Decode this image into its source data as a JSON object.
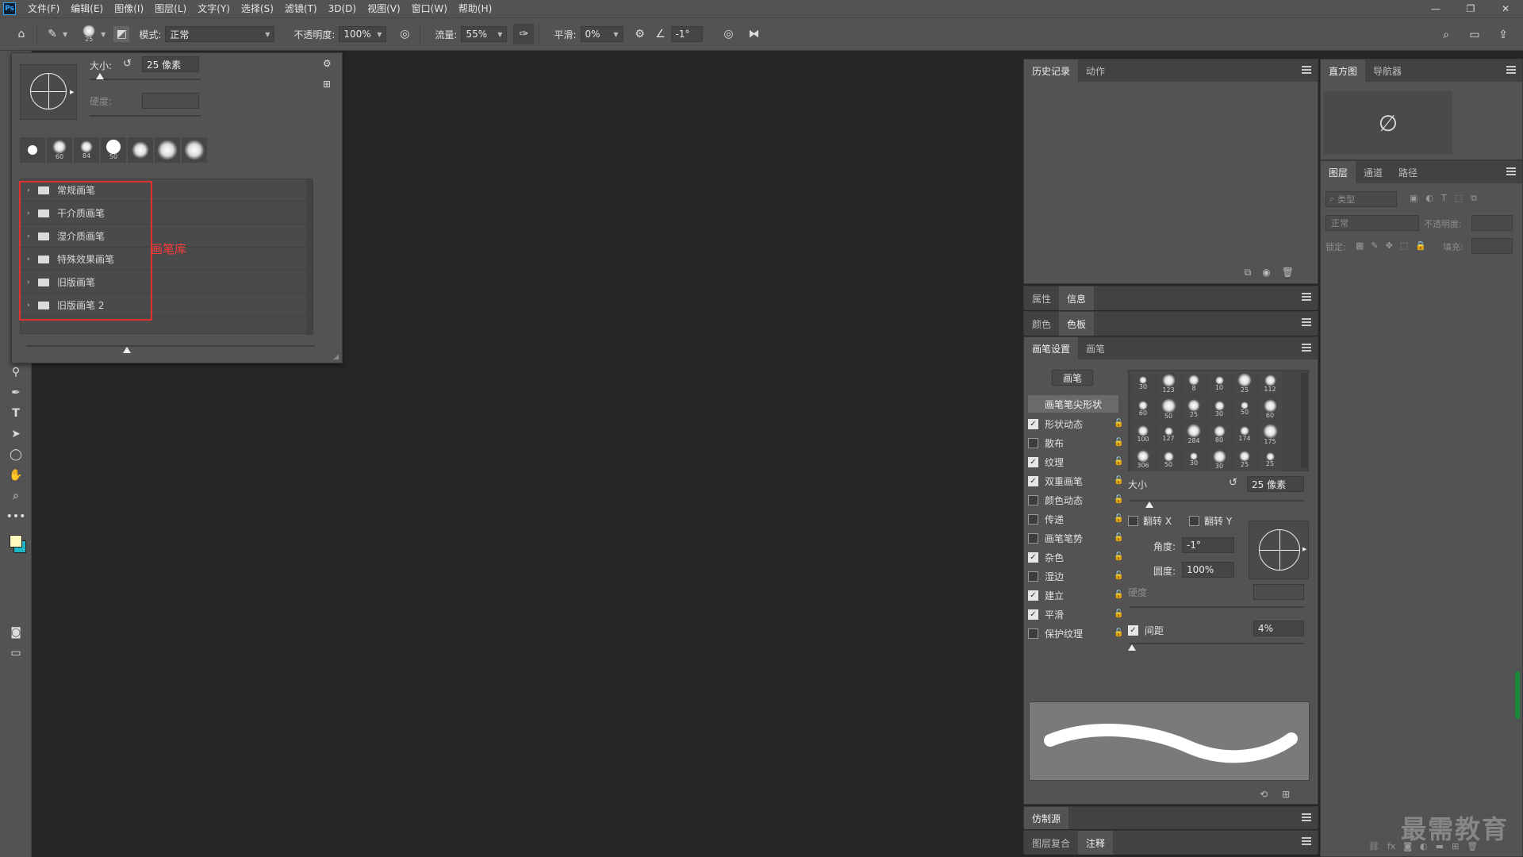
{
  "app": {
    "logo": "Ps"
  },
  "menu": [
    "文件(F)",
    "编辑(E)",
    "图像(I)",
    "图层(L)",
    "文字(Y)",
    "选择(S)",
    "滤镜(T)",
    "3D(D)",
    "视图(V)",
    "窗口(W)",
    "帮助(H)"
  ],
  "window_controls": {
    "minimize": "—",
    "restore": "❐",
    "close": "✕"
  },
  "options": {
    "brush_size_badge": "25",
    "mode_label": "模式:",
    "mode_value": "正常",
    "opacity_label": "不透明度:",
    "opacity_value": "100%",
    "flow_label": "流量:",
    "flow_value": "55%",
    "smooth_label": "平滑:",
    "smooth_value": "0%",
    "angle_value": "-1°"
  },
  "brush_popup": {
    "size_label": "大小:",
    "size_value": "25 像素",
    "hardness_label": "硬度:",
    "thumbs": [
      {
        "num": ""
      },
      {
        "num": "60"
      },
      {
        "num": "84"
      },
      {
        "num": "50"
      },
      {
        "num": ""
      },
      {
        "num": ""
      },
      {
        "num": ""
      }
    ],
    "groups": [
      "常规画笔",
      "干介质画笔",
      "湿介质画笔",
      "特殊效果画笔",
      "旧版画笔",
      "旧版画笔 2"
    ],
    "annotation": "画笔库"
  },
  "panels": {
    "history_tabs": [
      "历史记录",
      "动作"
    ],
    "histogram_tabs": [
      "直方图",
      "导航器"
    ],
    "layers_tabs": [
      "图层",
      "通道",
      "路径"
    ],
    "layers": {
      "search_placeholder": "类型",
      "blend_mode": "正常",
      "opacity_label": "不透明度:",
      "lock_label": "锁定:",
      "fill_label": "填充:"
    },
    "props_tabs": [
      "属性",
      "信息"
    ],
    "color_tabs": [
      "颜色",
      "色板"
    ],
    "brush_settings_tabs": [
      "画笔设置",
      "画笔"
    ],
    "clone_tabs": [
      "仿制源"
    ],
    "bottom_tabs": [
      "图层复合",
      "注释"
    ]
  },
  "brush_settings": {
    "brush_button": "画笔",
    "tip_shape": "画笔笔尖形状",
    "options": [
      {
        "label": "形状动态",
        "checked": true
      },
      {
        "label": "散布",
        "checked": false
      },
      {
        "label": "纹理",
        "checked": true
      },
      {
        "label": "双重画笔",
        "checked": true
      },
      {
        "label": "颜色动态",
        "checked": false
      },
      {
        "label": "传递",
        "checked": false
      },
      {
        "label": "画笔笔势",
        "checked": false
      },
      {
        "label": "杂色",
        "checked": true
      },
      {
        "label": "湿边",
        "checked": false
      },
      {
        "label": "建立",
        "checked": true
      },
      {
        "label": "平滑",
        "checked": true
      },
      {
        "label": "保护纹理",
        "checked": false
      }
    ],
    "presets": [
      "30",
      "123",
      "8",
      "10",
      "25",
      "112",
      "60",
      "50",
      "25",
      "30",
      "50",
      "60",
      "100",
      "127",
      "284",
      "80",
      "174",
      "175",
      "306",
      "50",
      "30",
      "30",
      "25",
      "25"
    ],
    "size_label": "大小",
    "size_value": "25 像素",
    "flip_x": "翻转 X",
    "flip_y": "翻转 Y",
    "angle_label": "角度:",
    "angle_value": "-1°",
    "roundness_label": "圆度:",
    "roundness_value": "100%",
    "hardness_label": "硬度",
    "spacing_label": "间距",
    "spacing_value": "4%"
  },
  "watermark": "最需教育",
  "colors": {
    "accent_red": "#e03030",
    "foreground": "#fff7c0",
    "background": "#1fb6c8"
  }
}
